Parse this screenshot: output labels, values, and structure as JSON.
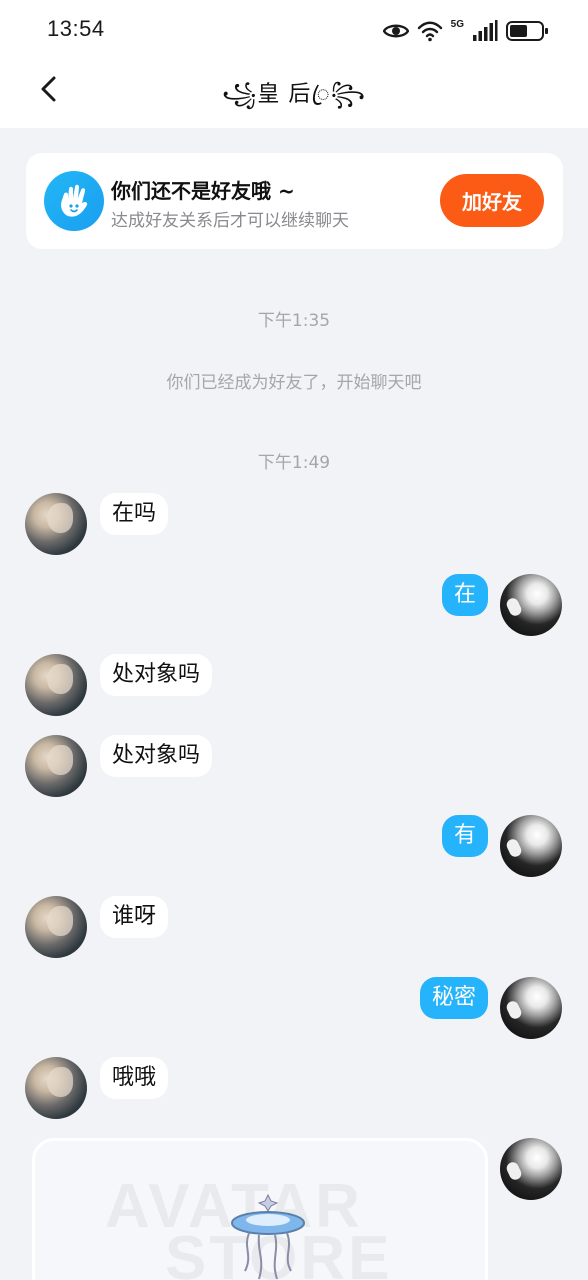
{
  "status_bar": {
    "time": "13:54",
    "network": "5G",
    "battery_level": 0.55
  },
  "header": {
    "title": "꧁皇 后ꦿ꧂"
  },
  "friend_banner": {
    "title": "你们还不是好友哦 ~",
    "subtitle": "达成好友关系后才可以继续聊天",
    "button": "加好友"
  },
  "timestamps": {
    "first": "下午1:35",
    "second": "下午1:49"
  },
  "system_notice": "你们已经成为好友了，开始聊天吧",
  "messages": [
    {
      "from": "them",
      "text": "在吗"
    },
    {
      "from": "me",
      "text": "在"
    },
    {
      "from": "them",
      "text": "处对象吗"
    },
    {
      "from": "them",
      "text": "处对象吗"
    },
    {
      "from": "me",
      "text": "有"
    },
    {
      "from": "them",
      "text": "谁呀"
    },
    {
      "from": "me",
      "text": "秘密"
    },
    {
      "from": "them",
      "text": "哦哦"
    }
  ],
  "image_message": {
    "from": "me",
    "watermark_line1": "AVATAR",
    "watermark_line2": "STORE"
  },
  "colors": {
    "accent": "#25b3fb",
    "add_button": "#fb5b14",
    "background": "#f2f3f7"
  }
}
